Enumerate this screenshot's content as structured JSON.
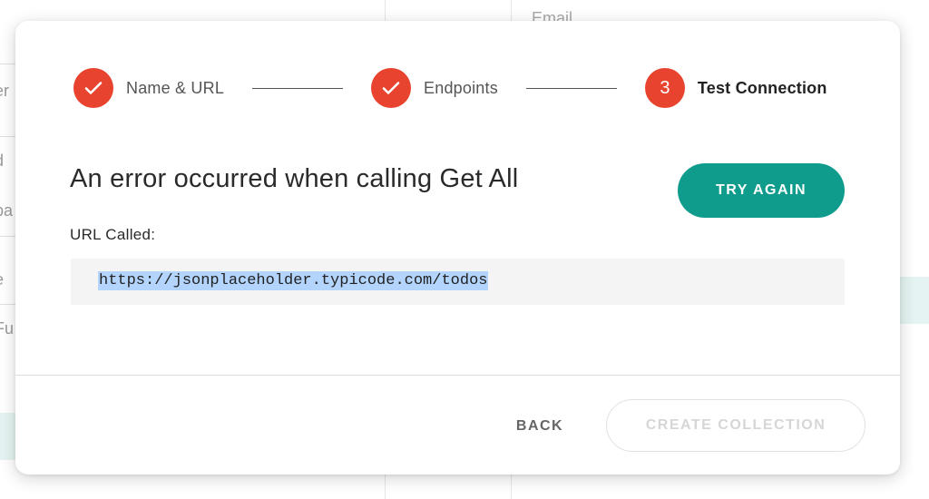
{
  "background": {
    "email_label": "Email",
    "row_fragments": [
      "er",
      "d",
      "pa",
      "e",
      "Fu"
    ]
  },
  "stepper": {
    "steps": [
      {
        "label": "Name & URL",
        "state": "complete",
        "icon": "check-icon"
      },
      {
        "label": "Endpoints",
        "state": "complete",
        "icon": "check-icon"
      },
      {
        "label": "Test Connection",
        "state": "active",
        "number": "3"
      }
    ]
  },
  "content": {
    "title": "An error occurred when calling Get All",
    "try_again_label": "TRY AGAIN",
    "url_label": "URL Called:",
    "url_value": "https://jsonplaceholder.typicode.com/todos"
  },
  "footer": {
    "back_label": "BACK",
    "create_label": "CREATE COLLECTION"
  },
  "colors": {
    "accent_red": "#e8432e",
    "primary_teal": "#0f9c8c",
    "selection_blue": "#b3d4fc"
  }
}
